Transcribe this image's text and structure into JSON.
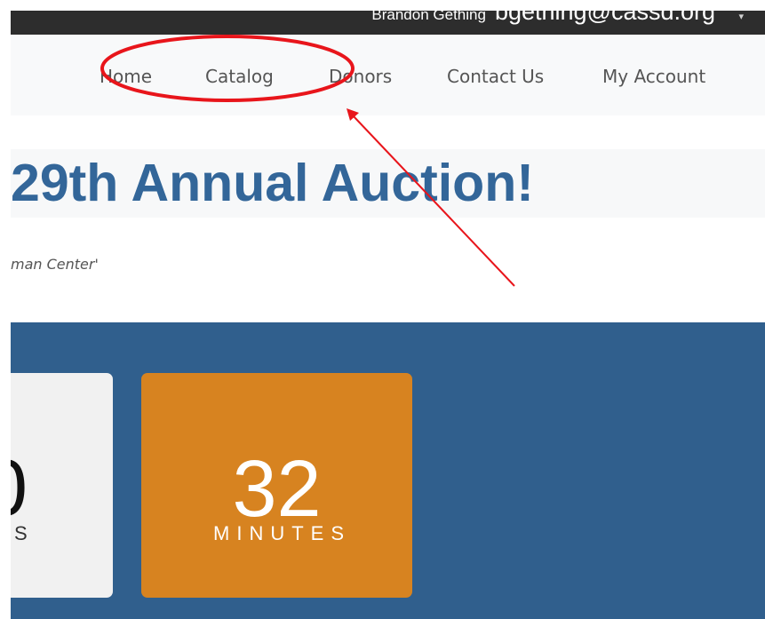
{
  "topbar": {
    "user_name": "Brandon Gething",
    "user_email": "bgething@cassd.org",
    "caret_icon": "caret-down-icon"
  },
  "nav": {
    "items": [
      {
        "label": "Home"
      },
      {
        "label": "Catalog"
      },
      {
        "label": "Donors"
      },
      {
        "label": "Contact Us"
      },
      {
        "label": "My Account"
      }
    ]
  },
  "hero": {
    "title": "29th Annual Auction!",
    "subtitle": "man Center'"
  },
  "countdown": {
    "cards": [
      {
        "value": "0",
        "unit": "S"
      },
      {
        "value": "32",
        "unit": "MINUTES"
      }
    ]
  },
  "annotation": {
    "color": "#e8151b",
    "shapes": [
      "ellipse-highlight",
      "arrow"
    ]
  },
  "colors": {
    "title": "#336699",
    "countdown_band": "#305f8d",
    "card_orange": "#d78320",
    "topbar": "#2d2d2d"
  }
}
